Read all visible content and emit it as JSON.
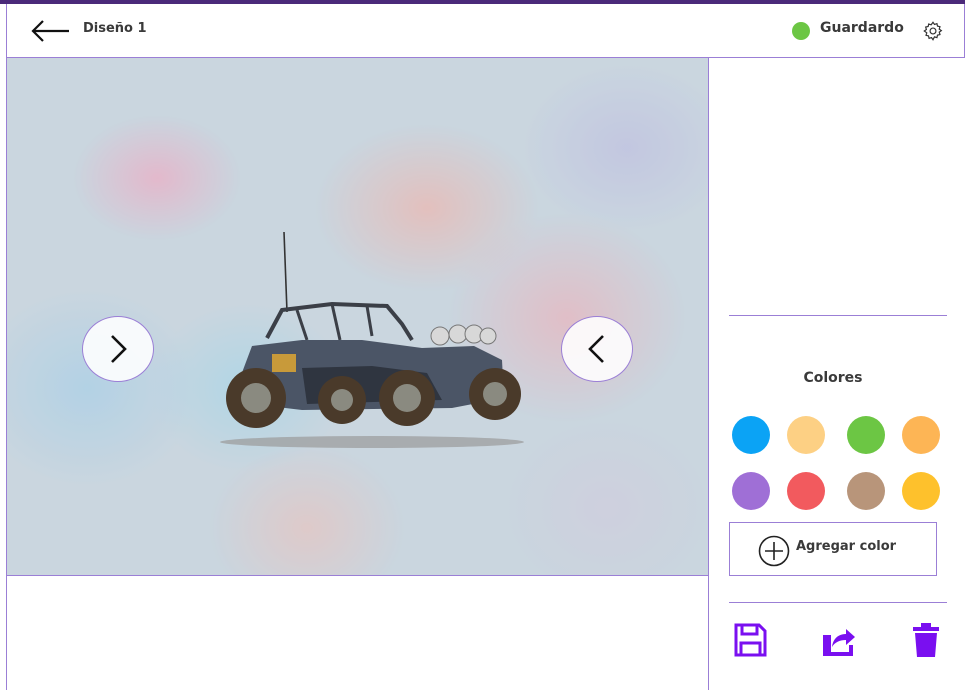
{
  "header": {
    "title": "Diseño 1",
    "status_label": "Guardardo",
    "status_color": "#6cc644",
    "back_icon": "arrow-left-icon",
    "settings_icon": "gear-icon"
  },
  "canvas": {
    "prev_icon": "chevron-right-icon",
    "next_icon": "chevron-left-icon",
    "model": "dune-buggy"
  },
  "colors_panel": {
    "label": "Colores",
    "swatches": [
      {
        "name": "blue",
        "color": "#0ba3f5"
      },
      {
        "name": "light-orange",
        "color": "#fdd084"
      },
      {
        "name": "green",
        "color": "#6cc644"
      },
      {
        "name": "orange",
        "color": "#fdb555"
      },
      {
        "name": "purple",
        "color": "#9f6fd6"
      },
      {
        "name": "red",
        "color": "#f25a5e"
      },
      {
        "name": "tan",
        "color": "#b8957a"
      },
      {
        "name": "yellow",
        "color": "#fec12c"
      }
    ],
    "add_label": "Agregar color"
  },
  "actions": {
    "save_icon": "floppy-disk-icon",
    "share_icon": "share-icon",
    "delete_icon": "trash-icon",
    "accent": "#7a0ff0"
  }
}
